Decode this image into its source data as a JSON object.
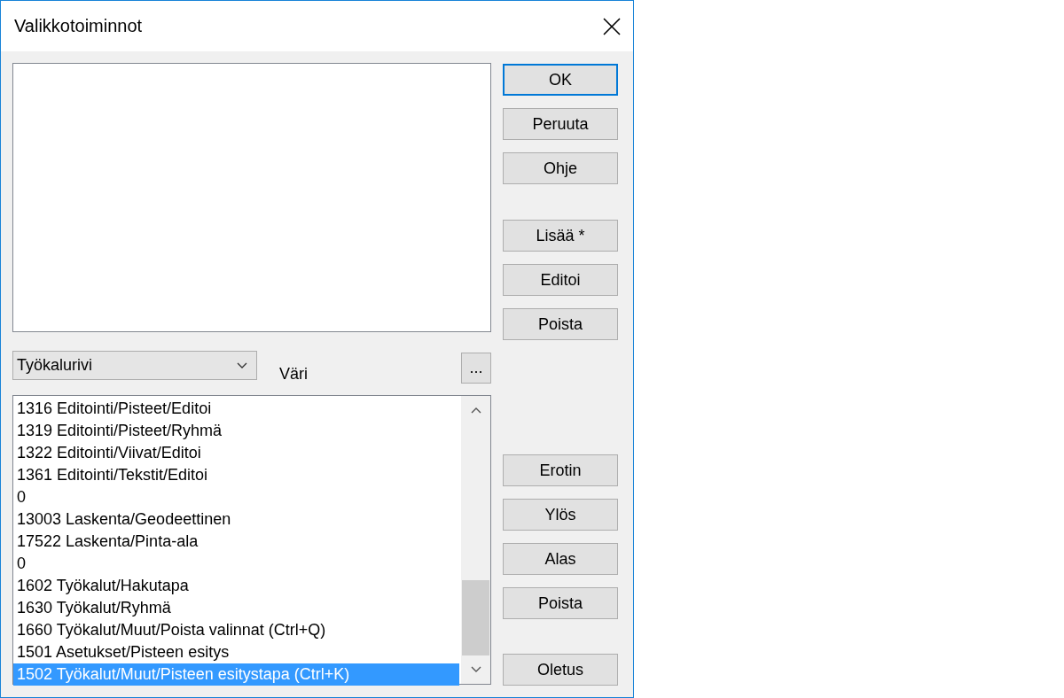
{
  "window": {
    "title": "Valikkotoiminnot"
  },
  "dropdown": {
    "value": "Työkalurivi"
  },
  "color_label": "Väri",
  "browse_button": "...",
  "items": [
    {
      "label": "1316 Editointi/Pisteet/Editoi",
      "selected": false
    },
    {
      "label": "1319 Editointi/Pisteet/Ryhmä",
      "selected": false
    },
    {
      "label": "1322 Editointi/Viivat/Editoi",
      "selected": false
    },
    {
      "label": "1361 Editointi/Tekstit/Editoi",
      "selected": false
    },
    {
      "label": "0",
      "selected": false
    },
    {
      "label": "13003 Laskenta/Geodeettinen",
      "selected": false
    },
    {
      "label": "17522 Laskenta/Pinta-ala",
      "selected": false
    },
    {
      "label": "0",
      "selected": false
    },
    {
      "label": "1602 Työkalut/Hakutapa",
      "selected": false
    },
    {
      "label": "1630 Työkalut/Ryhmä",
      "selected": false
    },
    {
      "label": "1660 Työkalut/Muut/Poista valinnat (Ctrl+Q)",
      "selected": false
    },
    {
      "label": "1501 Asetukset/Pisteen esitys",
      "selected": false
    },
    {
      "label": "1502 Työkalut/Muut/Pisteen esitystapa (Ctrl+K)",
      "selected": true
    }
  ],
  "button_groups": [
    [
      {
        "label": "OK",
        "default": true
      },
      {
        "label": "Peruuta",
        "default": false
      },
      {
        "label": "Ohje",
        "default": false
      }
    ],
    [
      {
        "label": "Lisää *",
        "default": false
      },
      {
        "label": "Editoi",
        "default": false
      },
      {
        "label": "Poista",
        "default": false
      }
    ],
    [
      {
        "label": "Erotin",
        "default": false
      },
      {
        "label": "Ylös",
        "default": false
      },
      {
        "label": "Alas",
        "default": false
      },
      {
        "label": "Poista",
        "default": false
      }
    ],
    [
      {
        "label": "Oletus",
        "default": false
      }
    ]
  ]
}
